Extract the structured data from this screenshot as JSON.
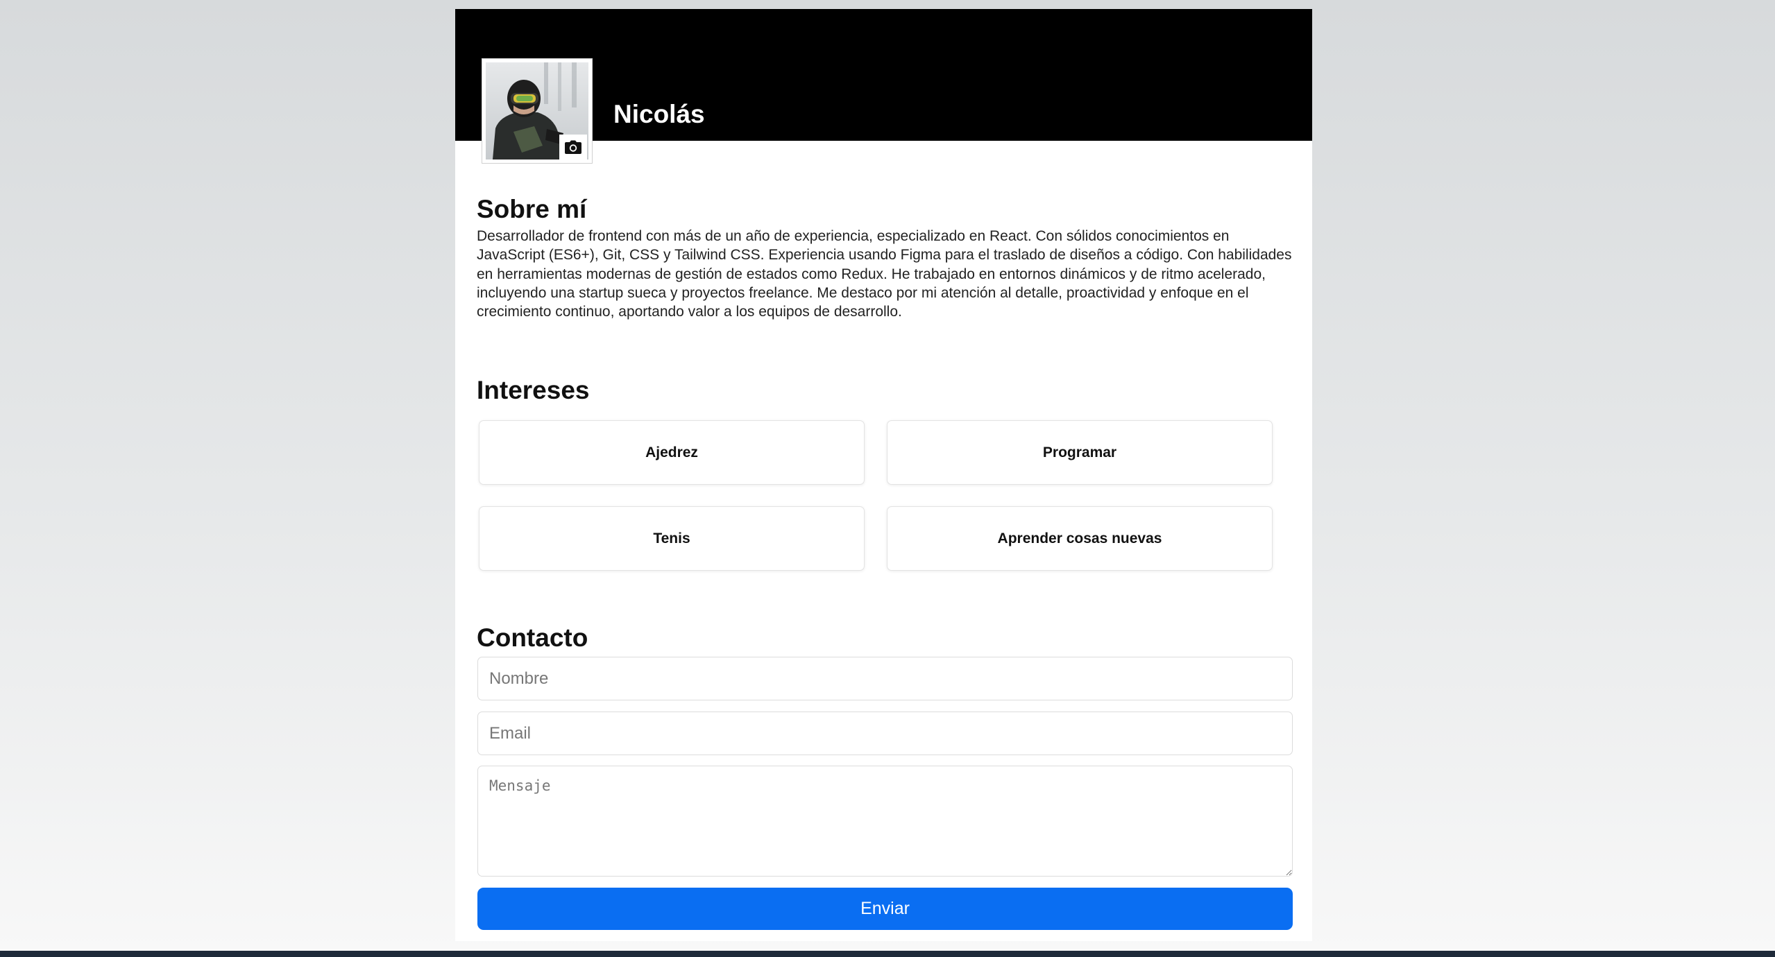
{
  "profile": {
    "name": "Nicolás"
  },
  "about": {
    "title": "Sobre mí",
    "text": "Desarrollador de frontend con más de un año de experiencia, especializado en React. Con sólidos conocimientos en JavaScript (ES6+), Git, CSS y Tailwind CSS. Experiencia usando Figma para el traslado de diseños a código. Con habilidades en herramientas modernas de gestión de estados como Redux. He trabajado en entornos dinámicos y de ritmo acelerado, incluyendo una startup sueca y proyectos freelance. Me destaco por mi atención al detalle, proactividad y enfoque en el crecimiento continuo, aportando valor a los equipos de desarrollo."
  },
  "interests": {
    "title": "Intereses",
    "items": [
      "Ajedrez",
      "Programar",
      "Tenis",
      "Aprender cosas nuevas"
    ]
  },
  "contact": {
    "title": "Contacto",
    "name_placeholder": "Nombre",
    "email_placeholder": "Email",
    "message_placeholder": "Mensaje",
    "submit_label": "Enviar"
  },
  "icons": {
    "avatar_edit": "camera-icon"
  },
  "colors": {
    "banner": "#000000",
    "accent": "#0a6ef2",
    "page_background": "#d7dadc"
  }
}
